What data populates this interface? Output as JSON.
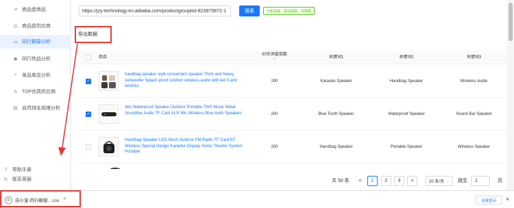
{
  "sidebar": {
    "items": [
      {
        "label": "商品盘商品",
        "icon": "trend-icon"
      },
      {
        "label": "商品盘供应商",
        "icon": "store-icon"
      },
      {
        "label": "同行橱窗分析",
        "icon": "window-icon"
      },
      {
        "label": "同行热品分析",
        "icon": "target-icon"
      },
      {
        "label": "单品单店分析",
        "icon": "search-icon"
      },
      {
        "label": "TOP优质供应商",
        "icon": "crown-icon"
      },
      {
        "label": "自然排名规律分析",
        "icon": "document-icon"
      }
    ],
    "footer": [
      {
        "label": "帮助手册",
        "icon": "help-icon"
      },
      {
        "label": "联系客服",
        "icon": "refresh-icon"
      }
    ]
  },
  "toolbar": {
    "url_value": "https://jzy-technology.en.alibaba.com/productgrouplist-823975872-1",
    "search_label": "搜索",
    "status_text": "分析完成，成功获取，失败数"
  },
  "export_label": "导出数据",
  "table": {
    "headers": {
      "product": "商品",
      "sales": "90天询盘指数",
      "sales_sub": "0",
      "keyword1": "关键词1",
      "keyword2": "关键词2",
      "keyword3": "关键词3"
    },
    "rows": [
      {
        "checked": true,
        "title": "handbag speaker style convenient speaker Thick and heavy subwoofer Splash-proof outdoor wireless audio with led 3 and lanches",
        "sales": "200",
        "kw1": "Karaoke Speaker",
        "kw2": "Handbag Speaker",
        "kw3": "Wireless Audio"
      },
      {
        "checked": true,
        "title": "Abs Waterproof Speaker Outdoor Portable TWS Music Metal Soundbar Audio TF Card AUX Mic Wireless Blue tooth Speakers",
        "sales": "200",
        "kw1": "Blue Tooth Speaker",
        "kw2": "Waterproof Speaker",
        "kw3": "Sound Bar Speaker"
      },
      {
        "checked": false,
        "title": "Handbag Speaker LED 5inch Outdoor FM Radio TF Card BT Wireless Special Design Karaoke Display Home Theatre System Portable",
        "sales": "200",
        "kw1": "Handbag Speaker",
        "kw2": "Portable Speaker",
        "kw3": "Wireless Speaker"
      }
    ]
  },
  "pagination": {
    "total": "共 50 条",
    "prev": "<",
    "pages": [
      "1",
      "2",
      "3"
    ],
    "current": "1",
    "next": ">",
    "page_size": "20 条/页",
    "jump_label": "跳至",
    "jump_value": "1",
    "page_unit": "页"
  },
  "download": {
    "filename": "店小宝-同行橱窗....csv",
    "more": "^",
    "show_all": "全部显示",
    "close": "×"
  },
  "colors": {
    "accent": "#1677ff",
    "annotation": "#e53935",
    "success": "#52c41a"
  }
}
